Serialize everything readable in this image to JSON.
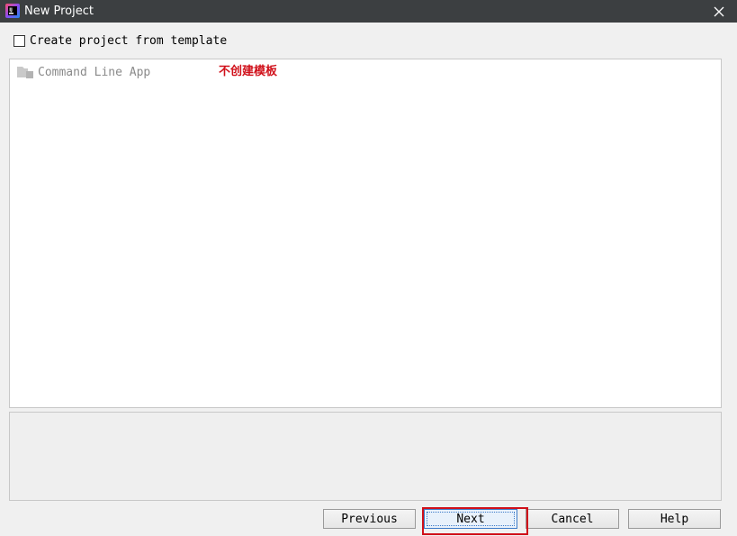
{
  "window": {
    "title": "New Project",
    "icon": "intellij-icon",
    "close_icon": "close-icon"
  },
  "options": {
    "create_from_template_label": "Create project from template",
    "create_from_template_checked": false
  },
  "template_list": {
    "items": [
      {
        "label": "Command Line App",
        "icon": "folder-icon"
      }
    ]
  },
  "annotation": {
    "text": "不创建模板",
    "color": "#d0101a"
  },
  "buttons": {
    "previous": "Previous",
    "next": "Next",
    "cancel": "Cancel",
    "help": "Help"
  },
  "colors": {
    "titlebar": "#3c3f41",
    "highlight": "#d0101a",
    "focus": "#3d7bc8"
  }
}
